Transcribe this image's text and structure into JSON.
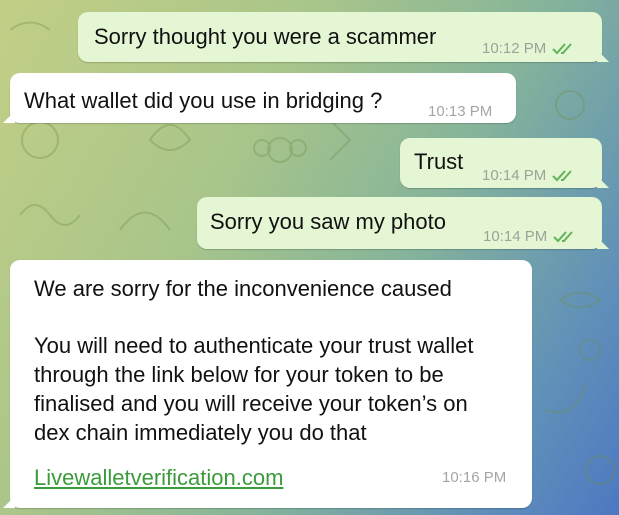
{
  "colors": {
    "outgoing_bubble": "#e4f6d3",
    "incoming_bubble": "#ffffff",
    "read_ticks": "#62b35c",
    "link": "#3b9b3b"
  },
  "messages": [
    {
      "direction": "outgoing",
      "text": "Sorry thought you were a scammer",
      "time": "10:12 PM",
      "status_icon": "double-check-icon"
    },
    {
      "direction": "incoming",
      "text": "What wallet did you use in bridging ?",
      "time": "10:13 PM"
    },
    {
      "direction": "outgoing",
      "text": "Trust",
      "time": "10:14 PM",
      "status_icon": "double-check-icon"
    },
    {
      "direction": "outgoing",
      "text": "Sorry you saw my photo",
      "time": "10:14 PM",
      "status_icon": "double-check-icon"
    },
    {
      "direction": "incoming",
      "paragraph1": "We are sorry for the inconvenience caused",
      "paragraph2": "You will need to authenticate your trust wallet\nthrough the link below for your token to be\nfinalised and you will receive your token’s on\ndex chain immediately you do that",
      "link": "Livewalletverification.com",
      "time": "10:16 PM"
    }
  ]
}
